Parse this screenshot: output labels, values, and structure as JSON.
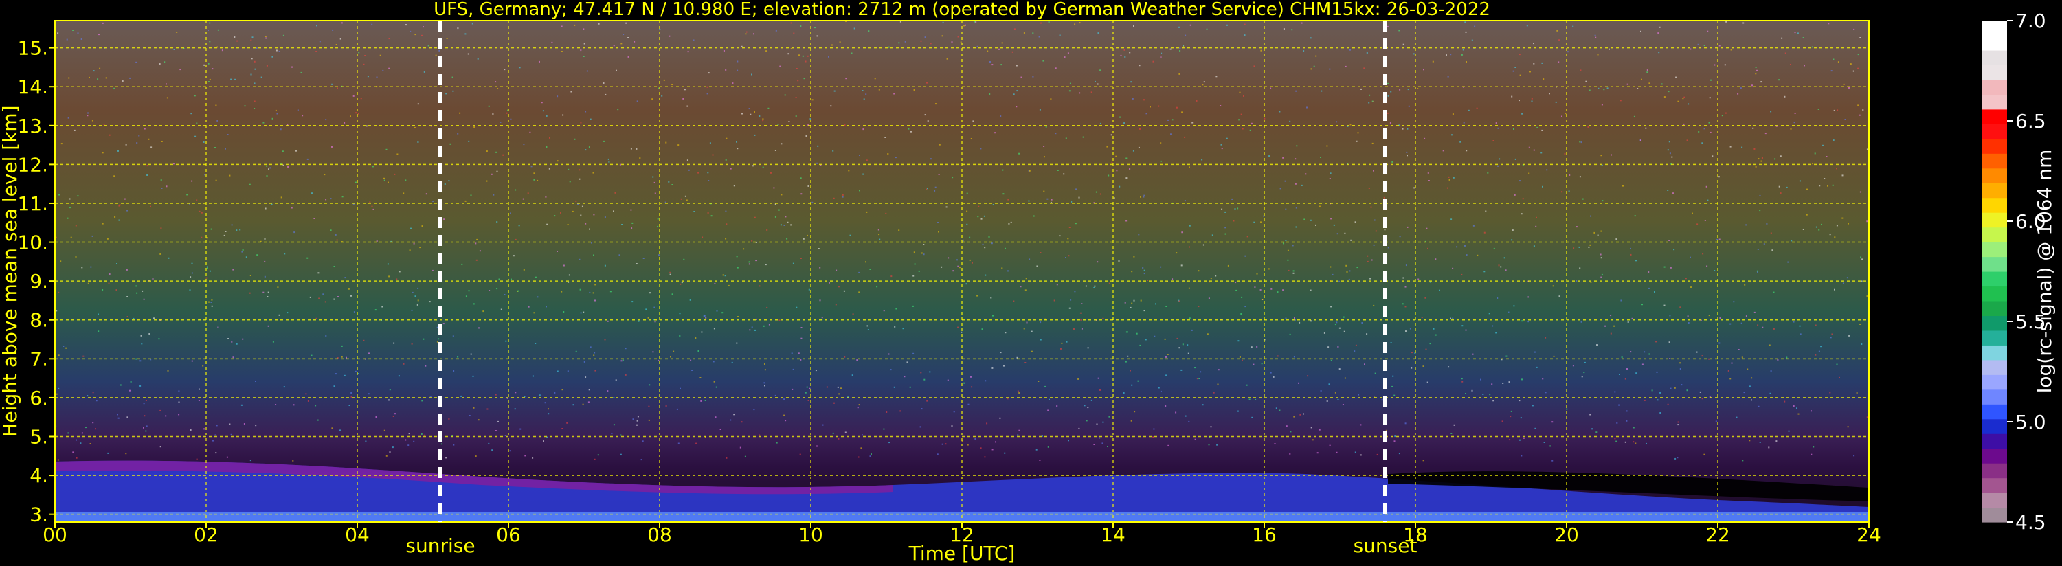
{
  "chart_data": {
    "type": "heatmap",
    "title": "UFS, Germany; 47.417 N / 10.980 E; elevation: 2712 m  (operated by German Weather Service)    CHM15kx: 26-03-2022",
    "xlabel": "Time [UTC]",
    "ylabel": "Height above mean sea level [km]",
    "x_ticks": [
      "00",
      "02",
      "04",
      "06",
      "08",
      "10",
      "12",
      "14",
      "16",
      "18",
      "20",
      "22",
      "24"
    ],
    "x_tick_values": [
      0,
      2,
      4,
      6,
      8,
      10,
      12,
      14,
      16,
      18,
      20,
      22,
      24
    ],
    "xlim": [
      0,
      24
    ],
    "y_ticks": [
      "3.",
      "4.",
      "5.",
      "6.",
      "7.",
      "8.",
      "9.",
      "10.",
      "11.",
      "12.",
      "13.",
      "14.",
      "15."
    ],
    "y_tick_values": [
      3,
      4,
      5,
      6,
      7,
      8,
      9,
      10,
      11,
      12,
      13,
      14,
      15
    ],
    "ylim": [
      2.8,
      15.7
    ],
    "grid": true,
    "markers": [
      {
        "label": "sunrise",
        "time": 5.1
      },
      {
        "label": "sunset",
        "time": 17.6
      }
    ],
    "colorbar": {
      "label": "log(rc-signal) @ 1064 nm",
      "range": [
        4.5,
        7.0
      ],
      "ticks": [
        "4.5",
        "5.0",
        "5.5",
        "6.0",
        "6.5",
        "7.0"
      ],
      "tick_values": [
        4.5,
        5.0,
        5.5,
        6.0,
        6.5,
        7.0
      ],
      "colors": [
        "#a08c9a",
        "#b58aa6",
        "#a35590",
        "#8a2f86",
        "#6c0a8d",
        "#3d0ea5",
        "#1a2ccf",
        "#2f55ff",
        "#6f86ff",
        "#9aa6ff",
        "#b3bbf2",
        "#7fd4e0",
        "#24b09a",
        "#109a6a",
        "#1aa84a",
        "#20c050",
        "#2ecf6a",
        "#6fe08a",
        "#9cef7a",
        "#c6f64c",
        "#eef225",
        "#ffd600",
        "#ffae00",
        "#ff8a00",
        "#ff6000",
        "#ff3000",
        "#ff1010",
        "#ff0000",
        "#f4c4c8",
        "#f2b8bc",
        "#ebe4e6",
        "#e6e1e3",
        "#ffffff",
        "#ffffff"
      ]
    }
  },
  "colors": {
    "accent": "#ffff00",
    "background": "#000000",
    "marker": "#ffffff"
  }
}
